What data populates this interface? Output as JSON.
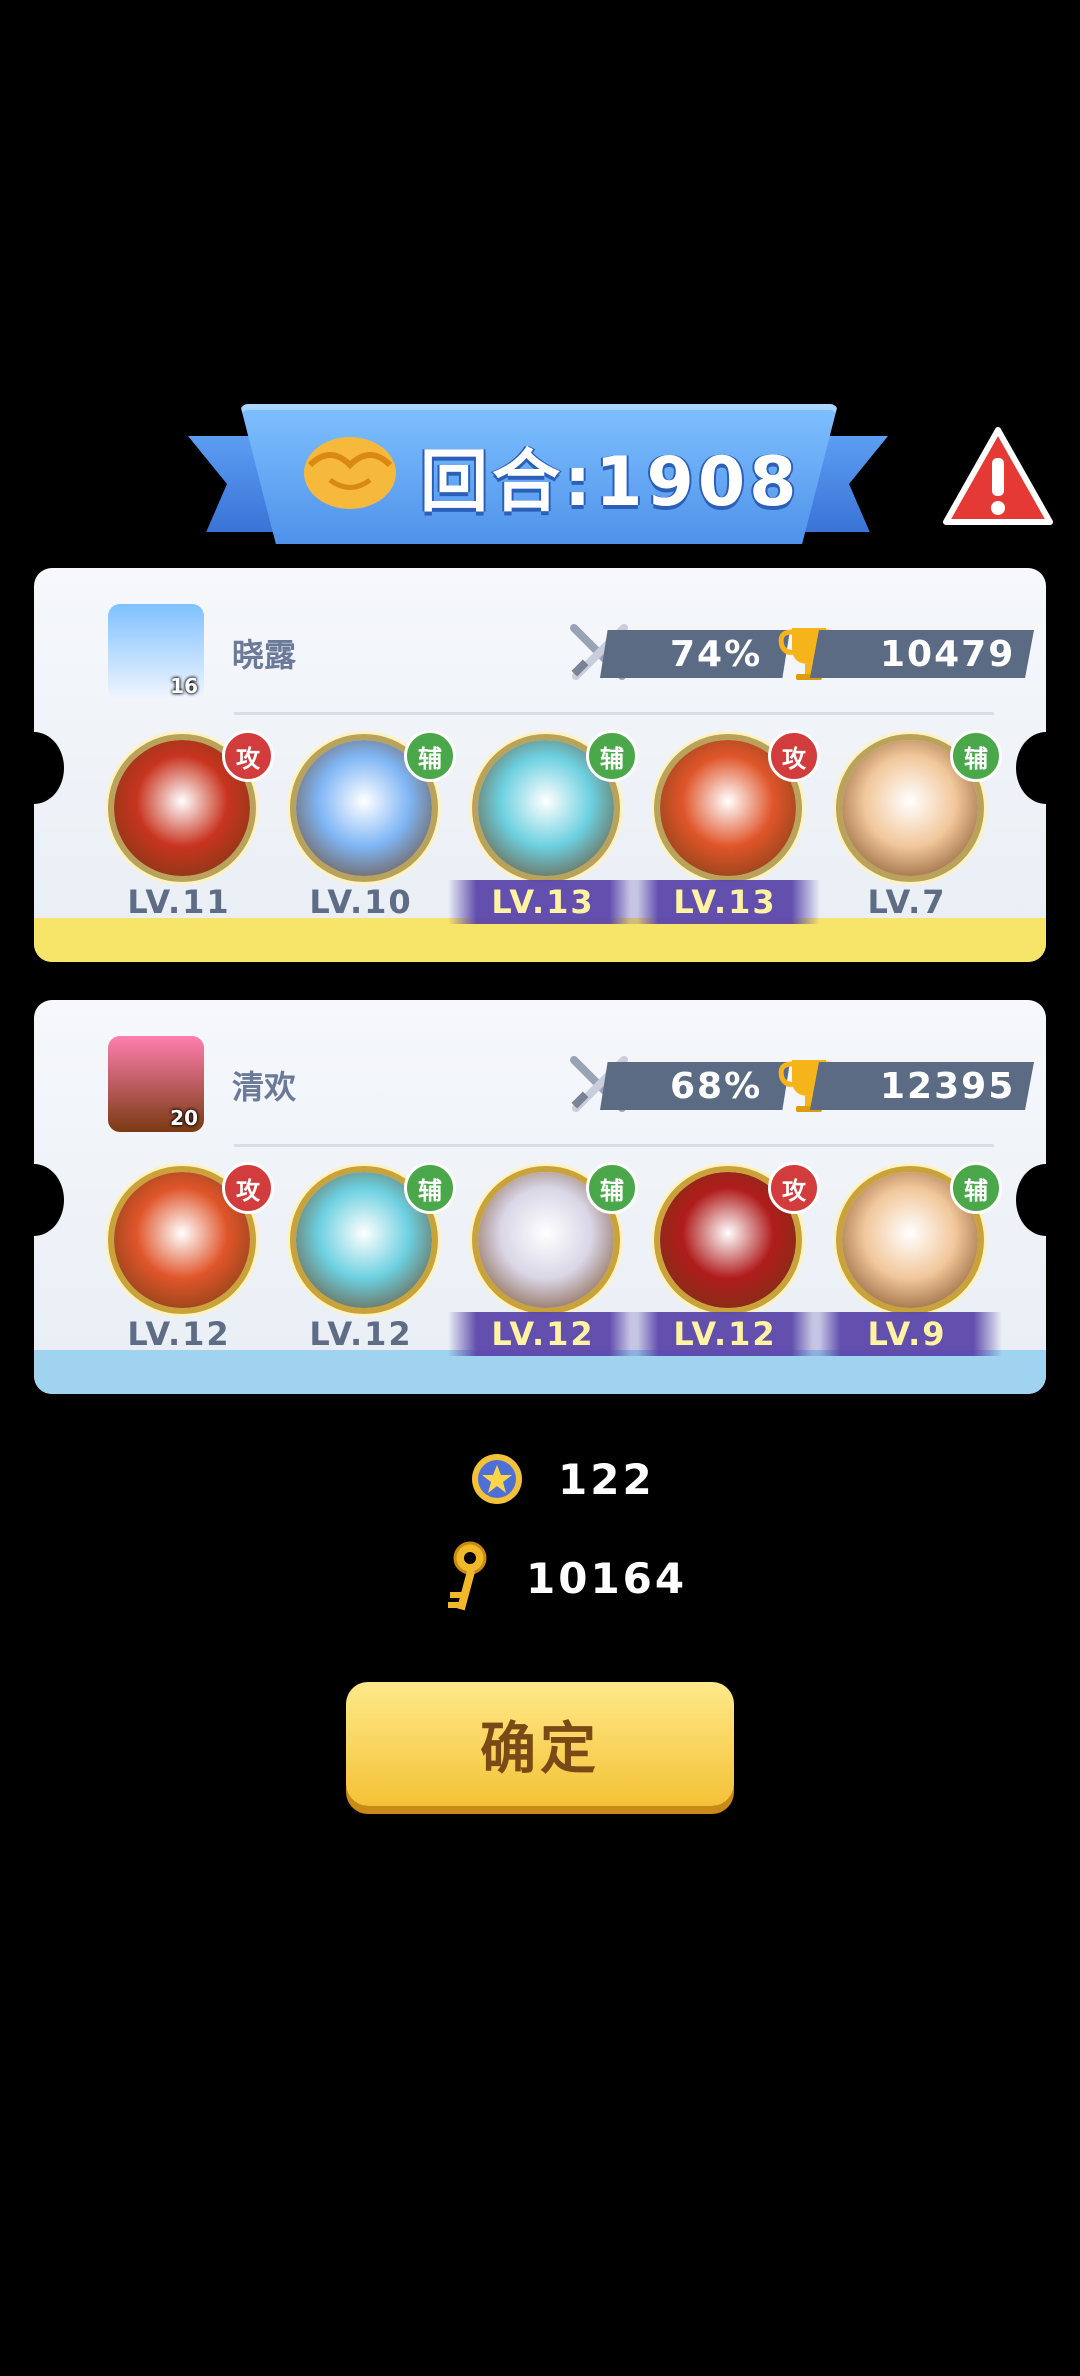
{
  "banner": {
    "title": "回合:1908",
    "icon": "handshake-icon"
  },
  "warning": {
    "icon": "warning-icon"
  },
  "teams": [
    {
      "player_name": "晓露",
      "avatar_level": "16",
      "win_rate": "74%",
      "trophies": "10479",
      "strip_color": "#f7e56a",
      "heroes": [
        {
          "role": "攻",
          "role_type": "atk",
          "level": "LV.11",
          "highlight": false,
          "color": "#c8341f"
        },
        {
          "role": "辅",
          "role_type": "sup",
          "level": "LV.10",
          "highlight": false,
          "color": "#7fb6f5"
        },
        {
          "role": "辅",
          "role_type": "sup",
          "level": "LV.13",
          "highlight": true,
          "color": "#6cd0e0"
        },
        {
          "role": "攻",
          "role_type": "atk",
          "level": "LV.13",
          "highlight": true,
          "color": "#e0552a"
        },
        {
          "role": "辅",
          "role_type": "sup",
          "level": "LV.7",
          "highlight": false,
          "color": "#f2c79b"
        }
      ]
    },
    {
      "player_name": "清欢",
      "avatar_level": "20",
      "win_rate": "68%",
      "trophies": "12395",
      "strip_color": "#9fd3ef",
      "heroes": [
        {
          "role": "攻",
          "role_type": "atk",
          "level": "LV.12",
          "highlight": false,
          "color": "#e0552a"
        },
        {
          "role": "辅",
          "role_type": "sup",
          "level": "LV.12",
          "highlight": false,
          "color": "#6cd0e0"
        },
        {
          "role": "辅",
          "role_type": "sup",
          "level": "LV.12",
          "highlight": true,
          "color": "#d9d6e6"
        },
        {
          "role": "攻",
          "role_type": "atk",
          "level": "LV.12",
          "highlight": true,
          "color": "#b01c1c"
        },
        {
          "role": "辅",
          "role_type": "sup",
          "level": "LV.9",
          "highlight": true,
          "color": "#f2c79b"
        }
      ]
    }
  ],
  "rewards": [
    {
      "icon": "star-coin-icon",
      "value": "122"
    },
    {
      "icon": "key-icon",
      "value": "10164"
    }
  ],
  "confirm_label": "确定"
}
